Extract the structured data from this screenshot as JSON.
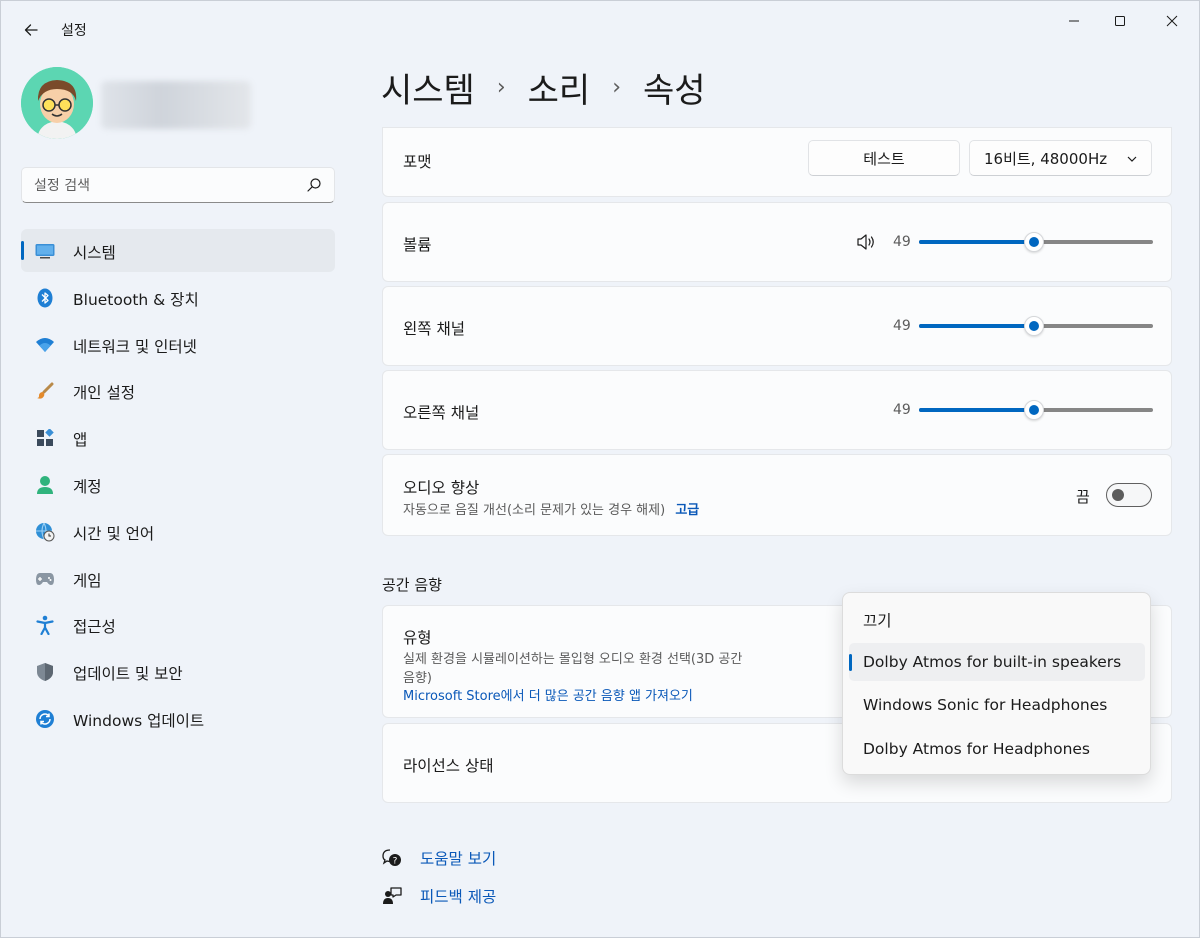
{
  "window": {
    "title": "설정"
  },
  "search": {
    "placeholder": "설정 검색"
  },
  "sidebar": {
    "items": [
      {
        "label": "시스템",
        "icon": "system-icon"
      },
      {
        "label": "Bluetooth & 장치",
        "icon": "bluetooth-icon"
      },
      {
        "label": "네트워크 및 인터넷",
        "icon": "wifi-icon"
      },
      {
        "label": "개인 설정",
        "icon": "brush-icon"
      },
      {
        "label": "앱",
        "icon": "apps-icon"
      },
      {
        "label": "계정",
        "icon": "account-icon"
      },
      {
        "label": "시간 및 언어",
        "icon": "globe-clock-icon"
      },
      {
        "label": "게임",
        "icon": "gamepad-icon"
      },
      {
        "label": "접근성",
        "icon": "accessibility-icon"
      },
      {
        "label": "업데이트 및 보안",
        "icon": "shield-icon"
      },
      {
        "label": "Windows 업데이트",
        "icon": "update-icon"
      }
    ]
  },
  "breadcrumb": {
    "part1": "시스템",
    "part2": "소리",
    "part3": "속성",
    "separator": "›"
  },
  "format": {
    "label": "포맷",
    "test_button": "테스트",
    "selected_format": "16비트, 48000Hz"
  },
  "volume": {
    "label": "볼륨",
    "value": "49",
    "level": 0.49
  },
  "left_channel": {
    "label": "왼쪽 채널",
    "value": "49",
    "level": 0.49
  },
  "right_channel": {
    "label": "오른쪽 채널",
    "value": "49",
    "level": 0.49
  },
  "audio_enhance": {
    "label": "오디오 향상",
    "description": "자동으로 음질 개선(소리 문제가 있는 경우 해제)",
    "advanced_link": "고급",
    "state_label": "끔",
    "on": false
  },
  "spatial": {
    "section_title": "공간 음향",
    "type_label": "유형",
    "type_description_1": "실제 환경을 시뮬레이션하는 몰입형 오디오 환경 선택(3D 공간",
    "type_description_2": "음향)",
    "store_link": "Microsoft Store에서 더 많은 공간 음향 앱 가져오기",
    "options": [
      "끄기",
      "Dolby Atmos for built-in speakers",
      "Windows Sonic for Headphones",
      "Dolby Atmos for Headphones"
    ],
    "selected_option": "Dolby Atmos for built-in speakers"
  },
  "license": {
    "label": "라이선스 상태"
  },
  "footer": {
    "help": "도움말 보기",
    "feedback": "피드백 제공"
  },
  "colors": {
    "accent": "#0067c0",
    "background": "#eff3f9",
    "card": "#fbfcfd"
  }
}
